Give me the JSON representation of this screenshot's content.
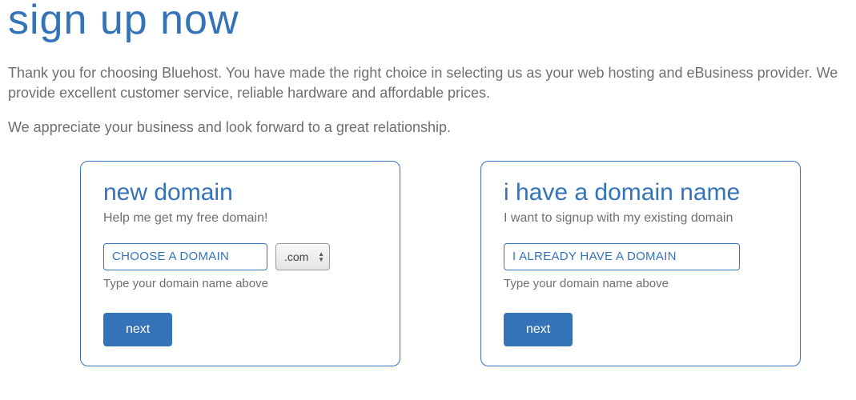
{
  "page": {
    "title": "sign up now",
    "intro1": "Thank you for choosing Bluehost. You have made the right choice in selecting us as your web hosting and eBusiness provider. We provide excellent customer service, reliable hardware and affordable prices.",
    "intro2": "We appreciate your business and look forward to a great relationship."
  },
  "newDomain": {
    "title": "new domain",
    "subtitle": "Help me get my free domain!",
    "placeholder": "CHOOSE A DOMAIN",
    "tld": ".com",
    "hint": "Type your domain name above",
    "button": "next"
  },
  "existingDomain": {
    "title": "i have a domain name",
    "subtitle": "I want to signup with my existing domain",
    "placeholder": "I ALREADY HAVE A DOMAIN",
    "hint": "Type your domain name above",
    "button": "next"
  }
}
